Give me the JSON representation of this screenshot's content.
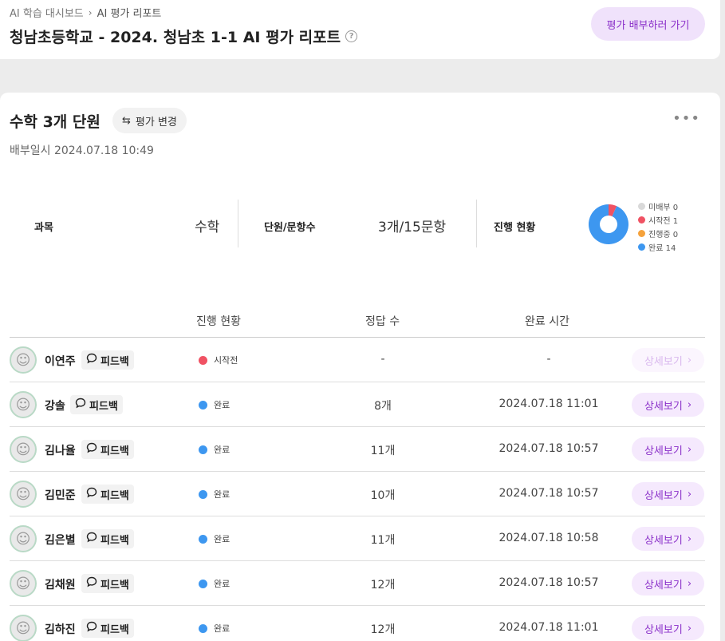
{
  "breadcrumb": {
    "parent": "AI 학습 대시보드",
    "separator": "›",
    "current": "AI 평가 리포트"
  },
  "header": {
    "title": "청남초등학교 - 2024. 청남초 1-1 AI 평가 리포트",
    "help_icon": "?",
    "go_button": "평가 배부하러 가기"
  },
  "section": {
    "title": "수학 3개 단원",
    "change_button": "평가 변경",
    "change_icon": "⇆",
    "more_icon": "•••",
    "date": "배부일시 2024.07.18 10:49"
  },
  "summary": {
    "subject_label": "과목",
    "subject_value": "수학",
    "units_label": "단원/문항수",
    "units_value": "3개/15문항",
    "progress_label": "진행 현황"
  },
  "chart_data": {
    "type": "pie",
    "donut": true,
    "slices": [
      {
        "label": "미배부",
        "value": 0,
        "color": "#d9d9d9"
      },
      {
        "label": "시작전",
        "value": 1,
        "color": "#f05263"
      },
      {
        "label": "진행중",
        "value": 0,
        "color": "#f5a23c"
      },
      {
        "label": "완료",
        "value": 14,
        "color": "#3d97f0"
      }
    ]
  },
  "legend": [
    {
      "text": "미배부 0",
      "color": "#d9d9d9"
    },
    {
      "text": "시작전 1",
      "color": "#f05263"
    },
    {
      "text": "진행중 0",
      "color": "#f5a23c"
    },
    {
      "text": "완료 14",
      "color": "#3d97f0"
    }
  ],
  "table": {
    "headers": {
      "status": "진행 현황",
      "score": "정답 수",
      "time": "완료 시간"
    },
    "feedback_label": "피드백",
    "detail_label": "상세보기",
    "rows": [
      {
        "name": "이연주",
        "status": "시작전",
        "status_color": "#f05263",
        "score": "-",
        "time": "-",
        "detail_enabled": false
      },
      {
        "name": "강솔",
        "status": "완료",
        "status_color": "#3d97f0",
        "score": "8개",
        "time": "2024.07.18 11:01",
        "detail_enabled": true
      },
      {
        "name": "김나율",
        "status": "완료",
        "status_color": "#3d97f0",
        "score": "11개",
        "time": "2024.07.18 10:57",
        "detail_enabled": true
      },
      {
        "name": "김민준",
        "status": "완료",
        "status_color": "#3d97f0",
        "score": "10개",
        "time": "2024.07.18 10:57",
        "detail_enabled": true
      },
      {
        "name": "김은별",
        "status": "완료",
        "status_color": "#3d97f0",
        "score": "11개",
        "time": "2024.07.18 10:58",
        "detail_enabled": true
      },
      {
        "name": "김채원",
        "status": "완료",
        "status_color": "#3d97f0",
        "score": "12개",
        "time": "2024.07.18 10:57",
        "detail_enabled": true
      },
      {
        "name": "김하진",
        "status": "완료",
        "status_color": "#3d97f0",
        "score": "12개",
        "time": "2024.07.18 11:01",
        "detail_enabled": true
      }
    ]
  }
}
